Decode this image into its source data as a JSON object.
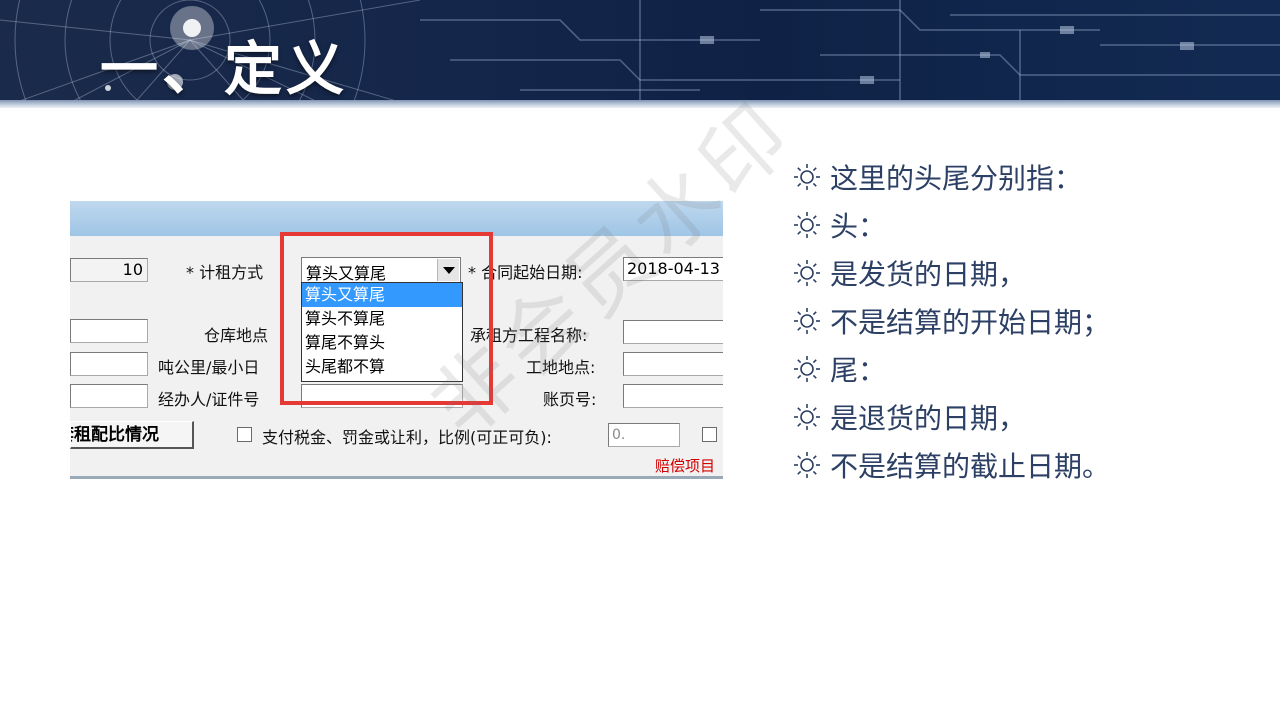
{
  "slide": {
    "title": "一、定义"
  },
  "screenshot": {
    "row1": {
      "num_value": "10",
      "rent_method_label": "* 计租方式",
      "rent_method_value": "算头又算尾",
      "start_date_label": "* 合同起始日期:",
      "start_date_value": "2018-04-13"
    },
    "dropdown_options": [
      "算头又算尾",
      "算头不算尾",
      "算尾不算头",
      "头尾都不算"
    ],
    "row2": {
      "warehouse_label": "仓库地点",
      "project_label": "承租方工程名称:"
    },
    "row3": {
      "tonkm_label": "吨公里/最小日",
      "site_label": "工地地点:"
    },
    "row4": {
      "agent_label": "经办人/证件号",
      "account_label": "账页号:"
    },
    "row5": {
      "tab_label": "套租配比情况",
      "tax_checkbox_label": "支付税金、罚金或让利，比例(可正可负):",
      "ratio_value": "0.",
      "compensation_label": "赔偿项目"
    }
  },
  "bullets": [
    "这里的头尾分别指：",
    "头：",
    "是发货的日期，",
    "不是结算的开始日期；",
    "尾：",
    "是退货的日期，",
    "不是结算的截止日期。"
  ],
  "watermark": "非会员水印",
  "colors": {
    "bullet_text": "#2c3f64",
    "highlight_frame": "#e53935",
    "dropdown_selected": "#3399ff"
  }
}
